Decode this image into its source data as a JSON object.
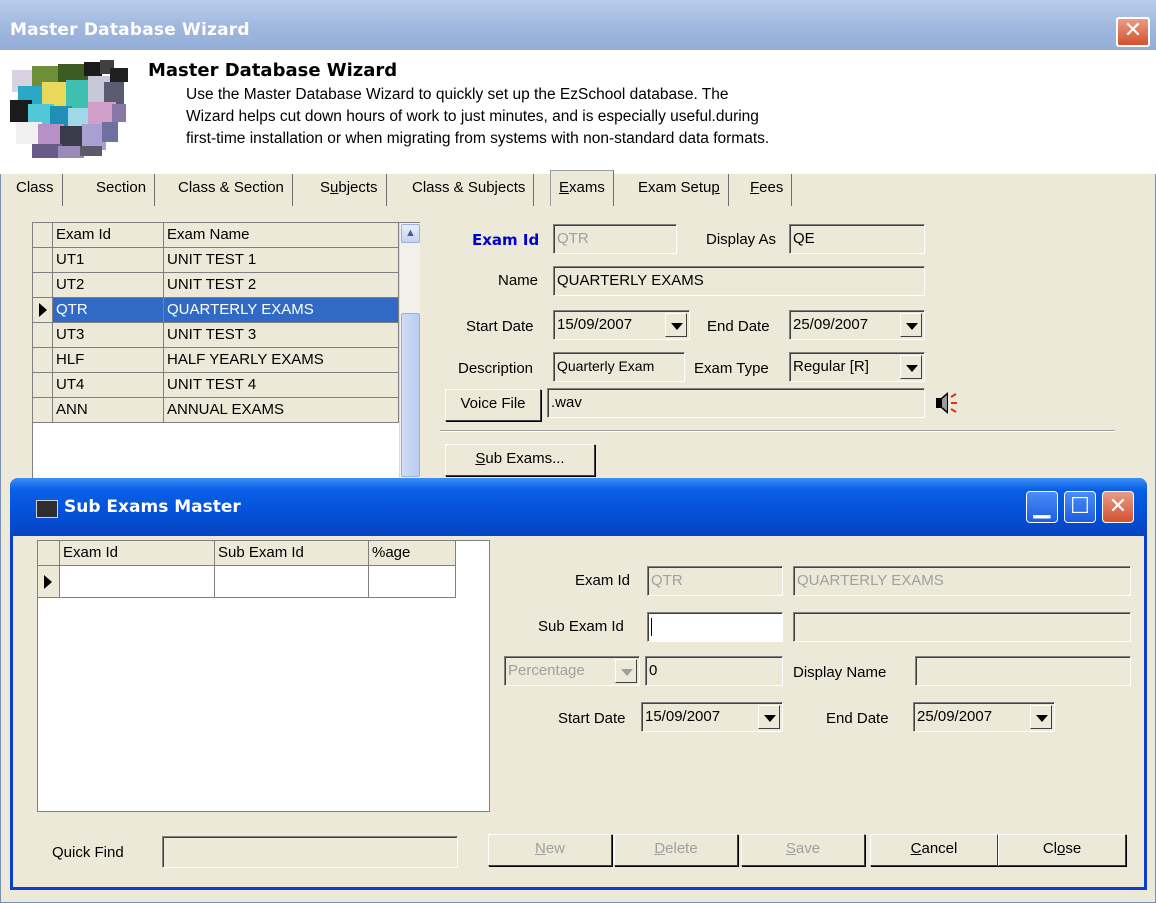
{
  "window": {
    "title": "Master Database Wizard",
    "close_glyph": "✕"
  },
  "header": {
    "title": "Master Database Wizard",
    "description": "Use the Master Database Wizard to quickly set up the EzSchool database. The\nWizard helps cut down hours of work to just minutes, and is especially useful.during\nfirst-time installation or when migrating from systems with non-standard data formats."
  },
  "tabs": [
    {
      "label": "Class"
    },
    {
      "label": "Section"
    },
    {
      "label": "Class & Section"
    },
    {
      "label": "Subjects",
      "mnemonic": "u"
    },
    {
      "label": "Class & Subjects"
    },
    {
      "label": "Exams",
      "mnemonic": "E",
      "active": true
    },
    {
      "label": "Exam Setup",
      "mnemonic": "p"
    },
    {
      "label": "Fees",
      "mnemonic": "F"
    }
  ],
  "exam_grid": {
    "columns": [
      "Exam Id",
      "Exam Name"
    ],
    "rows": [
      [
        "UT1",
        "UNIT TEST 1"
      ],
      [
        "UT2",
        "UNIT TEST 2"
      ],
      [
        "QTR",
        "QUARTERLY EXAMS"
      ],
      [
        "UT3",
        "UNIT TEST 3"
      ],
      [
        "HLF",
        "HALF YEARLY EXAMS"
      ],
      [
        "UT4",
        "UNIT TEST 4"
      ],
      [
        "ANN",
        "ANNUAL EXAMS"
      ]
    ],
    "selected_index": 2
  },
  "exam_form": {
    "exam_id_label": "Exam Id",
    "exam_id_value": "QTR",
    "display_as_label": "Display As",
    "display_as_value": "QE",
    "name_label": "Name",
    "name_value": "QUARTERLY EXAMS",
    "start_date_label": "Start Date",
    "start_date_value": "15/09/2007",
    "end_date_label": "End Date",
    "end_date_value": "25/09/2007",
    "description_label": "Description",
    "description_value": "Quarterly Exam",
    "exam_type_label": "Exam Type",
    "exam_type_value": "Regular [R]",
    "voice_file_button": "Voice File",
    "voice_file_value": ".wav",
    "speaker_icon": "speaker-icon",
    "sub_exams_button": "Sub Exams..."
  },
  "sub_window": {
    "title": "Sub Exams Master",
    "grid": {
      "columns": [
        "Exam Id",
        "Sub Exam Id",
        "%age"
      ],
      "rows": [
        [
          "",
          "",
          ""
        ]
      ]
    },
    "form": {
      "exam_id_label": "Exam Id",
      "exam_id_value": "QTR",
      "exam_name_value": "QUARTERLY EXAMS",
      "sub_exam_id_label": "Sub Exam Id",
      "sub_exam_id_value": "",
      "sub_exam_name_value": "",
      "percentage_select": "Percentage",
      "percentage_value": "0",
      "display_name_label": "Display Name",
      "display_name_value": "",
      "start_date_label": "Start Date",
      "start_date_value": "15/09/2007",
      "end_date_label": "End Date",
      "end_date_value": "25/09/2007"
    },
    "quick_find_label": "Quick Find",
    "quick_find_value": "",
    "buttons": {
      "new": "New",
      "delete": "Delete",
      "save": "Save",
      "cancel": "Cancel",
      "close": "Close"
    }
  },
  "colors": {
    "xp_blue": "#0551da",
    "selection": "#316ac5",
    "label_blue": "#0000cc",
    "face": "#ece9d8"
  }
}
